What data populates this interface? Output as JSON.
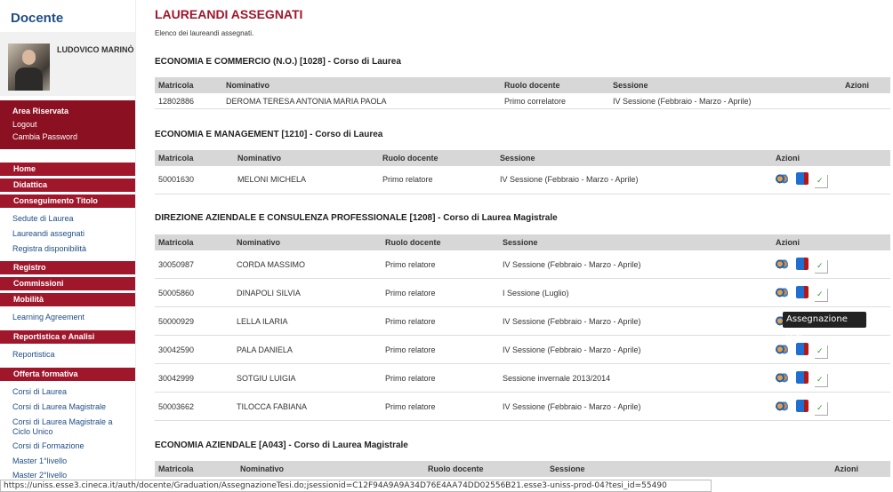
{
  "sidebar": {
    "title": "Docente",
    "profile_name": "LUDOVICO MARINÒ",
    "reserved": {
      "title": "Area Riservata",
      "logout": "Logout",
      "change_password": "Cambia Password"
    },
    "menu": {
      "home": "Home",
      "didattica": "Didattica",
      "conseguimento": "Conseguimento Titolo",
      "sedute": "Sedute di Laurea",
      "laureandi": "Laureandi assegnati",
      "registra": "Registra disponibilità",
      "registro": "Registro",
      "commissioni": "Commissioni",
      "mobilita": "Mobilità",
      "learning": "Learning Agreement",
      "reportistica_h": "Reportistica e Analisi",
      "reportistica": "Reportistica",
      "offerta": "Offerta formativa",
      "corsi_laurea": "Corsi di Laurea",
      "corsi_magistrale": "Corsi di Laurea Magistrale",
      "corsi_ciclo": "Corsi di Laurea Magistrale a Ciclo Unico",
      "corsi_formazione": "Corsi di Formazione",
      "master1": "Master 1°livello",
      "master2": "Master 2°livello"
    }
  },
  "main": {
    "title": "LAUREANDI ASSEGNATI",
    "subtitle": "Elenco dei laureandi assegnati.",
    "headers": {
      "matricola": "Matricola",
      "nominativo": "Nominativo",
      "ruolo": "Ruolo docente",
      "sessione": "Sessione",
      "azioni": "Azioni"
    },
    "sections": [
      {
        "title": "ECONOMIA E COMMERCIO (N.O.) [1028] - Corso di Laurea",
        "rows": [
          {
            "matricola": "12802886",
            "nominativo": "DEROMA TERESA ANTONIA MARIA PAOLA",
            "ruolo": "Primo correlatore",
            "sessione": "IV Sessione (Febbraio - Marzo - Aprile)"
          }
        ]
      },
      {
        "title": "ECONOMIA E MANAGEMENT [1210] - Corso di Laurea",
        "rows": [
          {
            "matricola": "50001630",
            "nominativo": "MELONI MICHELA",
            "ruolo": "Primo relatore",
            "sessione": "IV Sessione (Febbraio - Marzo - Aprile)"
          }
        ]
      },
      {
        "title": "DIREZIONE AZIENDALE E CONSULENZA PROFESSIONALE [1208] - Corso di Laurea Magistrale",
        "rows": [
          {
            "matricola": "30050987",
            "nominativo": "CORDA MASSIMO",
            "ruolo": "Primo relatore",
            "sessione": "IV Sessione (Febbraio - Marzo - Aprile)"
          },
          {
            "matricola": "50005860",
            "nominativo": "DINAPOLI SILVIA",
            "ruolo": "Primo relatore",
            "sessione": "I Sessione (Luglio)"
          },
          {
            "matricola": "50000929",
            "nominativo": "LELLA ILARIA",
            "ruolo": "Primo relatore",
            "sessione": "IV Sessione (Febbraio - Marzo - Aprile)"
          },
          {
            "matricola": "30042590",
            "nominativo": "PALA DANIELA",
            "ruolo": "Primo relatore",
            "sessione": "IV Sessione (Febbraio - Marzo - Aprile)"
          },
          {
            "matricola": "30042999",
            "nominativo": "SOTGIU LUIGIA",
            "ruolo": "Primo relatore",
            "sessione": "Sessione invernale 2013/2014"
          },
          {
            "matricola": "50003662",
            "nominativo": "TILOCCA FABIANA",
            "ruolo": "Primo relatore",
            "sessione": "IV Sessione (Febbraio - Marzo - Aprile)"
          }
        ]
      },
      {
        "title": "ECONOMIA AZIENDALE [A043] - Corso di Laurea Magistrale",
        "rows": []
      }
    ],
    "tooltip": "Assegnazione tesi"
  },
  "statusbar": "https://uniss.esse3.cineca.it/auth/docente/Graduation/AssegnazioneTesi.do;jsessionid=C12F94A9A9A34D76E4AA74DD02556B21.esse3-uniss-prod-04?tesi_id=55490"
}
